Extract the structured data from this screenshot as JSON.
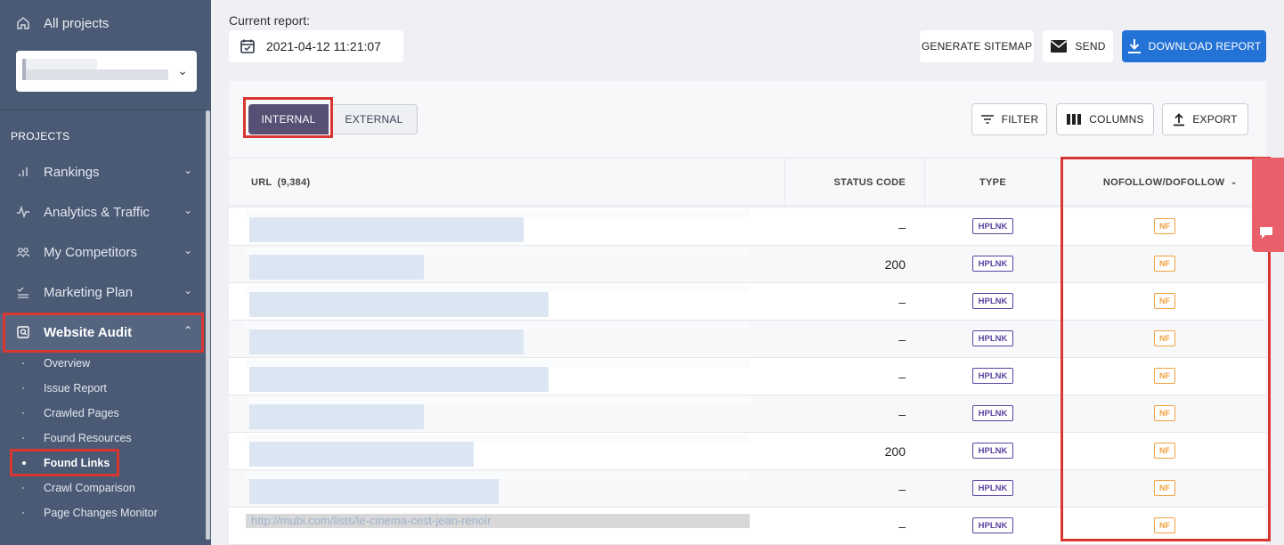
{
  "sidebar": {
    "all_projects": "All projects",
    "projects_label": "PROJECTS",
    "items": [
      {
        "label": "Rankings",
        "icon": "bar-chart-icon"
      },
      {
        "label": "Analytics & Traffic",
        "icon": "pulse-icon"
      },
      {
        "label": "My Competitors",
        "icon": "users-icon"
      },
      {
        "label": "Marketing Plan",
        "icon": "checklist-icon"
      },
      {
        "label": "Website Audit",
        "icon": "audit-icon"
      }
    ],
    "subitems": [
      {
        "label": "Overview"
      },
      {
        "label": "Issue Report"
      },
      {
        "label": "Crawled Pages"
      },
      {
        "label": "Found Resources"
      },
      {
        "label": "Found Links"
      },
      {
        "label": "Crawl Comparison"
      },
      {
        "label": "Page Changes Monitor"
      }
    ]
  },
  "header": {
    "current_report_label": "Current report:",
    "report_date": "2021-04-12 11:21:07",
    "generate_sitemap": "GENERATE SITEMAP",
    "send": "SEND",
    "download_report": "DOWNLOAD REPORT"
  },
  "toolbar": {
    "tab_internal": "INTERNAL",
    "tab_external": "EXTERNAL",
    "filter": "FILTER",
    "columns": "COLUMNS",
    "export": "EXPORT"
  },
  "table": {
    "headers": {
      "url": "URL",
      "url_count": "(9,384)",
      "status_code": "STATUS CODE",
      "type": "TYPE",
      "nofollow": "NOFOLLOW/DOFOLLOW"
    },
    "rows": [
      {
        "status": "–",
        "type": "HPLNK",
        "follow": "NF"
      },
      {
        "status": "200",
        "type": "HPLNK",
        "follow": "NF"
      },
      {
        "status": "–",
        "type": "HPLNK",
        "follow": "NF"
      },
      {
        "status": "–",
        "type": "HPLNK",
        "follow": "NF"
      },
      {
        "status": "–",
        "type": "HPLNK",
        "follow": "NF"
      },
      {
        "status": "–",
        "type": "HPLNK",
        "follow": "NF"
      },
      {
        "status": "200",
        "type": "HPLNK",
        "follow": "NF"
      },
      {
        "status": "–",
        "type": "HPLNK",
        "follow": "NF"
      },
      {
        "status": "–",
        "type": "HPLNK",
        "follow": "NF",
        "url": "http://mubi.com/lists/le-cinema-cest-jean-renoir"
      }
    ]
  },
  "colors": {
    "sidebar_bg": "#4a5a75",
    "accent_blue": "#2372d6",
    "tab_active": "#585074",
    "highlight_red": "#d93631",
    "hplnk": "#5b43a0",
    "nf_orange": "#f0a040"
  }
}
